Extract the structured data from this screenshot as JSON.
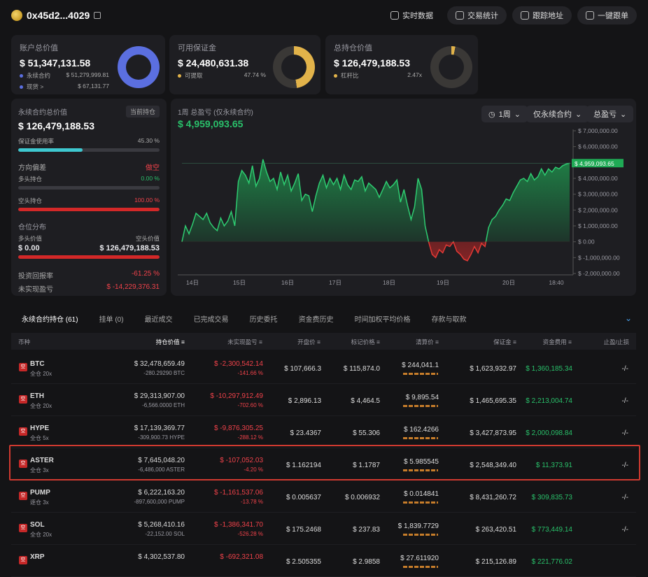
{
  "header": {
    "address": "0x45d2...4029",
    "buttons": [
      "实时数据",
      "交易统计",
      "跟踪地址",
      "一键跟单"
    ]
  },
  "summary": [
    {
      "label": "账户总价值",
      "value": "$ 51,347,131.58",
      "rows": [
        {
          "name": "永续合约",
          "val": "$ 51,279,999.81"
        },
        {
          "name": "现货 >",
          "val": "$ 67,131.77"
        }
      ],
      "donut_fraction": 0.999,
      "color": "#5b6fe0"
    },
    {
      "label": "可用保证金",
      "value": "$ 24,480,631.38",
      "rows": [
        {
          "name": "可提取",
          "val": "47.74 %"
        }
      ],
      "donut_fraction": 0.4774,
      "color": "#e2b34a"
    },
    {
      "label": "总持仓价值",
      "value": "$ 126,479,188.53",
      "rows": [
        {
          "name": "杠杆比",
          "val": "2.47x"
        }
      ],
      "donut_fraction": 0.03,
      "color": "#e2b34a"
    }
  ],
  "perp": {
    "label": "永续合约总价值",
    "badge": "当前持仓",
    "value": "$ 126,479,188.53",
    "margin_label": "保证金使用率",
    "margin_pct": "45.30 %",
    "margin_fraction": 0.453,
    "direction_label": "方向偏差",
    "direction": "做空",
    "long_label": "多头持仓",
    "long_pct": "0.00 %",
    "short_label": "空头持仓",
    "short_pct": "100.00 %",
    "dist_label": "仓位分布",
    "long_value_label": "多头价值",
    "short_value_label": "空头价值",
    "long_value": "$ 0.00",
    "short_value": "$ 126,479,188.53",
    "roi_label": "投资回报率",
    "roi": "-61.25 %",
    "upnl_label": "未实现盈亏",
    "upnl": "$ -14,229,376.31"
  },
  "chart_panel": {
    "title": "1周 总盈亏 (仅永续合约)",
    "value": "$ 4,959,093.65",
    "period": "1周",
    "filter": "仅永续合约",
    "metric": "总盈亏",
    "current_label": "$ 4,959,093.65"
  },
  "chart_data": {
    "type": "area",
    "title": "1周 总盈亏 (仅永续合约)",
    "x_ticks": [
      "14日",
      "15日",
      "16日",
      "17日",
      "18日",
      "19日",
      "20日",
      "18:40"
    ],
    "y_ticks": [
      "$ 7,000,000.00",
      "$ 6,000,000.00",
      "$ 5,000,000.00",
      "$ 4,000,000.00",
      "$ 3,000,000.00",
      "$ 2,000,000.00",
      "$ 1,000,000.00",
      "$ 0.00",
      "$ -1,000,000.00",
      "$ -2,000,000.00"
    ],
    "ylim": [
      -2000000,
      7000000
    ],
    "values": [
      0,
      1000000,
      500000,
      1100000,
      1800000,
      1600000,
      1400000,
      1800000,
      1200000,
      900000,
      700000,
      1500000,
      1000000,
      1300000,
      1900000,
      1000000,
      3800000,
      4500000,
      4200000,
      3700000,
      4800000,
      3500000,
      4000000,
      5200000,
      4400000,
      3800000,
      4000000,
      3300000,
      4400000,
      3600000,
      4200000,
      3200000,
      3700000,
      4300000,
      2600000,
      3000000,
      2900000,
      1900000,
      2900000,
      3700000,
      4200000,
      3400000,
      4000000,
      3600000,
      4000000,
      3300000,
      4200000,
      3600000,
      3300000,
      3900000,
      3800000,
      4100000,
      3200000,
      3700000,
      3500000,
      3300000,
      2800000,
      3300000,
      3800000,
      3400000,
      3600000,
      3900000,
      2500000,
      3300000,
      2300000,
      1400000,
      2200000,
      4000000,
      3300000,
      1000000,
      0,
      -800000,
      -1000000,
      -500000,
      -700000,
      -200000,
      -300000,
      0,
      -600000,
      -800000,
      -1100000,
      -1200000,
      -800000,
      -300000,
      -700000,
      -100000,
      -300000,
      900000,
      1400000,
      1600000,
      2000000,
      2300000,
      2700000,
      2600000,
      3100000,
      3500000,
      3900000,
      4000000,
      3800000,
      4300000,
      3900000,
      4100000,
      4600000,
      4200000,
      4600000,
      4400000,
      4700000,
      4600000,
      4800000,
      4900000,
      4959093
    ]
  },
  "tabs": [
    "永续合约持仓 (61)",
    "挂单 (0)",
    "最近成交",
    "已完成交易",
    "历史委托",
    "资金费历史",
    "时间加权平均价格",
    "存款与取款"
  ],
  "table": {
    "headers": [
      "币种",
      "持仓价值",
      "未实现盈亏",
      "开盘价",
      "标记价格",
      "清算价",
      "保证金",
      "资金费用",
      "止盈/止损"
    ],
    "rows": [
      {
        "coin": "BTC",
        "mode": "全仓 20x",
        "value": "$ 32,478,659.49",
        "size": "-280.29290 BTC",
        "pnl": "$ -2,300,542.14",
        "pnl_pct": "-141.66 %",
        "open": "$ 107,666.3",
        "mark": "$ 115,874.0",
        "liq": "$ 244,041.1",
        "margin": "$ 1,623,932.97",
        "funding": "$ 1,360,185.34",
        "tpsl": "-/-"
      },
      {
        "coin": "ETH",
        "mode": "全仓 20x",
        "value": "$ 29,313,907.00",
        "size": "-6,566.0000 ETH",
        "pnl": "$ -10,297,912.49",
        "pnl_pct": "-702.60 %",
        "open": "$ 2,896.13",
        "mark": "$ 4,464.5",
        "liq": "$ 9,895.54",
        "margin": "$ 1,465,695.35",
        "funding": "$ 2,213,004.74",
        "tpsl": "-/-"
      },
      {
        "coin": "HYPE",
        "mode": "全仓 5x",
        "value": "$ 17,139,369.77",
        "size": "-309,900.73 HYPE",
        "pnl": "$ -9,876,305.25",
        "pnl_pct": "-288.12 %",
        "open": "$ 23.4367",
        "mark": "$ 55.306",
        "liq": "$ 162.4266",
        "margin": "$ 3,427,873.95",
        "funding": "$ 2,000,098.84",
        "tpsl": "-/-"
      },
      {
        "coin": "ASTER",
        "mode": "全仓 3x",
        "value": "$ 7,645,048.20",
        "size": "-6,486,000 ASTER",
        "pnl": "$ -107,052.03",
        "pnl_pct": "-4.20 %",
        "open": "$ 1.162194",
        "mark": "$ 1.1787",
        "liq": "$ 5.985545",
        "margin": "$ 2,548,349.40",
        "funding": "$ 11,373.91",
        "tpsl": "-/-"
      },
      {
        "coin": "PUMP",
        "mode": "逐仓 3x",
        "value": "$ 6,222,163.20",
        "size": "-897,600,000 PUMP",
        "pnl": "$ -1,161,537.06",
        "pnl_pct": "-13.78 %",
        "open": "$ 0.005637",
        "mark": "$ 0.006932",
        "liq": "$ 0.014841",
        "margin": "$ 8,431,260.72",
        "funding": "$ 309,835.73",
        "tpsl": "-/-"
      },
      {
        "coin": "SOL",
        "mode": "全仓 20x",
        "value": "$ 5,268,410.16",
        "size": "-22,152.00 SOL",
        "pnl": "$ -1,386,341.70",
        "pnl_pct": "-526.28 %",
        "open": "$ 175.2468",
        "mark": "$ 237.83",
        "liq": "$ 1,839.7729",
        "margin": "$ 263,420.51",
        "funding": "$ 773,449.14",
        "tpsl": "-/-"
      },
      {
        "coin": "XRP",
        "mode": "",
        "value": "$ 4,302,537.80",
        "size": "",
        "pnl": "$ -692,321.08",
        "pnl_pct": "",
        "open": "$ 2.505355",
        "mark": "$ 2.9858",
        "liq": "$ 27.611920",
        "margin": "$ 215,126.89",
        "funding": "$ 221,776.02",
        "tpsl": ""
      }
    ]
  }
}
